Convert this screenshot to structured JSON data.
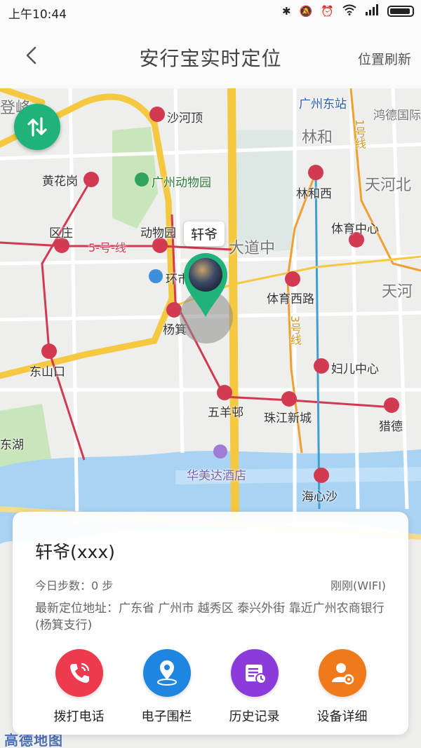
{
  "status": {
    "time": "上午10:44"
  },
  "header": {
    "title": "安行宝实时定位",
    "refresh_label": "位置刷新"
  },
  "map": {
    "labels": {
      "shahedin": "沙河顶",
      "huanghuagang": "黄花岗",
      "zoo": "广州动物园",
      "guangzhoudong": "广州东站",
      "hongde": "鸿德国际",
      "linhe": "林和",
      "linhexi": "林和西",
      "tianhebei": "天河北",
      "tiyuzhongxin": "体育中心",
      "ouzhuang": "区庄",
      "dongwuyuan": "动物园",
      "line5": "5-号-线",
      "huanshi": "环市东",
      "dadaozhong": "大道中",
      "tiyuxilu": "体育西路",
      "tianhe": "天河",
      "yangji": "杨箕",
      "line3": "3号线",
      "line1": "1号线",
      "dongshankou": "东山口",
      "funvzhongxin": "妇儿中心",
      "wuyangcun": "五羊邨",
      "zhujiangxincheng": "珠江新城",
      "liede": "猎德",
      "donghu": "东湖",
      "huameida": "华美达酒店",
      "haixinsha": "海心沙",
      "denfeng": "登峰"
    },
    "device_tag": "轩爷",
    "logo": "高德地图"
  },
  "card": {
    "device_name": "轩爷(xxx)",
    "steps": "今日步数：0 步",
    "network": "刚刚(WIFI)",
    "address": "最新定位地址：广东省 广州市 越秀区 泰兴外街 靠近广州农商银行(杨箕支行)",
    "actions": [
      {
        "label": "拨打电话",
        "icon": "phone-icon",
        "color": "#ee3a4f"
      },
      {
        "label": "电子围栏",
        "icon": "location-pin-icon",
        "color": "#1e86e0"
      },
      {
        "label": "历史记录",
        "icon": "history-icon",
        "color": "#8a3bd9"
      },
      {
        "label": "设备详细",
        "icon": "user-settings-icon",
        "color": "#f07a1a"
      }
    ]
  },
  "colors": {
    "accent_green": "#1fb37a",
    "ring_road": "#f5c842",
    "metro_red": "#d23a52"
  }
}
